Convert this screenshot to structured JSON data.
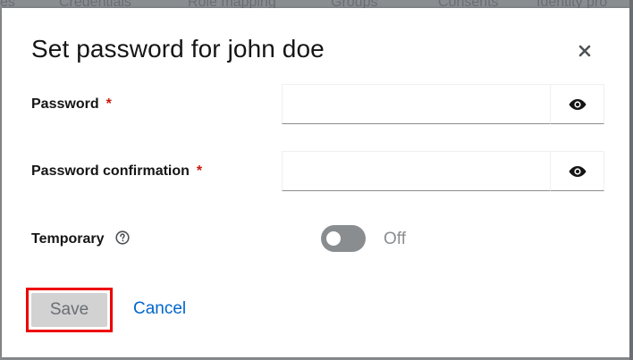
{
  "background": {
    "tabs": [
      "es",
      "Credentials",
      "Role mapping",
      "Groups",
      "Consents",
      "Identity pro"
    ]
  },
  "modal": {
    "title": "Set password for john doe",
    "close_icon": "close-icon",
    "fields": {
      "password": {
        "label": "Password",
        "required_mark": "*",
        "value": "",
        "toggle_icon": "eye-icon"
      },
      "password_confirmation": {
        "label": "Password confirmation",
        "required_mark": "*",
        "value": "",
        "toggle_icon": "eye-icon"
      },
      "temporary": {
        "label": "Temporary",
        "help_icon": "help-circle-icon",
        "state_label": "Off",
        "checked": false
      }
    },
    "actions": {
      "save_label": "Save",
      "cancel_label": "Cancel"
    }
  },
  "colors": {
    "required": "#c9190b",
    "link": "#0066cc",
    "toggle_off": "#8a8d90",
    "highlight": "#ee0000"
  }
}
